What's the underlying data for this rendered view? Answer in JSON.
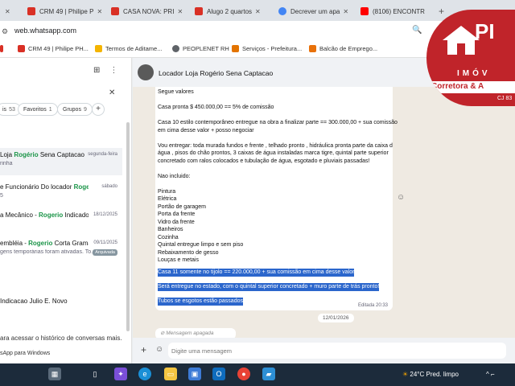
{
  "browser": {
    "tabs": [
      {
        "title": "CRM 49 | Philipe P",
        "color": "#d93025"
      },
      {
        "title": "CASA NOVA: PRI",
        "color": "#d93025"
      },
      {
        "title": "Alugo 2 quartos",
        "color": "#d93025"
      },
      {
        "title": "Decrever um apa",
        "color": "#4285f4"
      },
      {
        "title": "(8106) ENCONTR",
        "color": "#ff0000"
      }
    ],
    "url": "web.whatsapp.com",
    "bookmarks": [
      "CRM 49 | Philipe PH...",
      "Termos de Aditame...",
      "PEOPLENET RH",
      "Serviços - Prefeitura...",
      "Balcão de Emprego..."
    ]
  },
  "left_panel": {
    "filters": [
      {
        "label": "is",
        "count": "53"
      },
      {
        "label": "Favoritos",
        "count": "1"
      },
      {
        "label": "Grupos",
        "count": "9"
      }
    ],
    "chats": [
      {
        "name_prefix": "Loja ",
        "highlight": "Rogério",
        "name_suffix": " Sena Captacao",
        "time": "segunda-feira",
        "preview": "rinha"
      },
      {
        "name_prefix": "e Funcionário Do locador ",
        "highlight": "Rogerio",
        "name_suffix": "",
        "time": "sábado",
        "preview": "5"
      },
      {
        "name_prefix": "a Mecânico - ",
        "highlight": "Rogerio",
        "name_suffix": " Indicado P...",
        "time": "18/12/2025",
        "preview": ""
      },
      {
        "name_prefix": "embléia - ",
        "highlight": "Rogerio",
        "name_suffix": " Corta Grama, ...",
        "time": "09/11/2025",
        "preview": "gens temporárias foram ativadas. To...",
        "badge": "Arquivada"
      },
      {
        "name_prefix": " Indicacao Julio E. Novo",
        "highlight": "",
        "name_suffix": "",
        "time": "",
        "preview": ""
      }
    ],
    "footer_line1": "ara acessar o histórico de conversas mais.",
    "footer_line2": "sApp para Windows"
  },
  "chat": {
    "title": "Locador Loja Rogério Sena Captacao",
    "message_lines": [
      "Segue valores",
      "",
      "Casa pronta $ 450.000,00 == 5% de comissão",
      "",
      "Casa 10  estilo contemporâneo entregue na obra a finalizar parte  == 300.000,00 + sua comissão",
      "em cima desse valor + posso negociar",
      "",
      "Vou entregar: toda murada fundos e frente , telhado pronto , hidráulica pronta parte da caixa d",
      "água , pisos do chão prontos, 3 caixas de água instaladas marca tigre, quintal parte superior",
      "concretado com ralos colocados e tubulação de água, esgotado e pluviais passadas!",
      "",
      "Nao incluido:",
      "",
      "Pintura",
      "Elétrica",
      "Portão de garagem",
      "Porta da frente",
      "Vidro da frente",
      "Banheiros",
      "Cozinha",
      "Quintal entregue limpo e sem piso",
      "Rebaixamento de gesso",
      "Louças e metais"
    ],
    "selected_lines": [
      "Casa 11 somente no tijolo == 220.000,00 + sua comissão em cima desse valor",
      "Será entregue no estado, com o quintal superior concretado + muro parte de trás pronto!",
      "Tubos se esgotos estão passados"
    ],
    "edited_label": "Editada 20:33",
    "date_chip": "12/01/2026",
    "deleted_label": "Mensagem apagada",
    "composer_placeholder": "Digite uma mensagem"
  },
  "watermark": {
    "top": "PI",
    "imoveis": "IMÓV",
    "corretora": "Corretora & A",
    "cj": "CJ 83"
  },
  "taskbar": {
    "weather": "24°C  Pred. limpo"
  }
}
